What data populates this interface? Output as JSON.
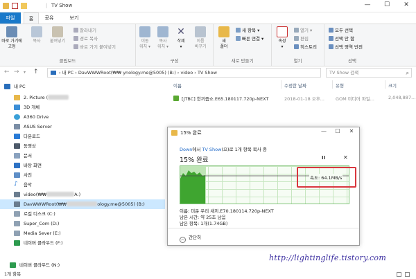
{
  "window": {
    "title": "TV Show",
    "separator": "|",
    "controls": {
      "minimize": "—",
      "maximize": "☐",
      "close": "✕"
    }
  },
  "ribbon_tabs": {
    "file": "파일",
    "home": "홈",
    "share": "공유",
    "view": "보기"
  },
  "ribbon": {
    "pin_quick": "바로 가기에\n고정",
    "copy": "복사",
    "paste": "붙여넣기",
    "cut": "잘라내기",
    "copy_path": "경로 복사",
    "paste_shortcut": "바로 가기 붙여넣기",
    "clipboard_group": "클립보드",
    "move_to": "이동\n위치 ▾",
    "copy_to": "복사\n위치 ▾",
    "delete": "삭제\n▾",
    "rename": "이름\n바꾸기",
    "organize_group": "구성",
    "new_folder": "새\n폴더",
    "new_item": "새 항목 ▾",
    "easy_access": "빠른 연결 ▾",
    "new_group": "새로 만들기",
    "properties": "속성\n▾",
    "open": "열기 ▾",
    "edit": "편집",
    "history": "히스토리",
    "open_group": "열기",
    "select_all": "모두 선택",
    "select_none": "선택 안 함",
    "invert_selection": "선택 영역 반전",
    "select_group": "선택"
  },
  "address": {
    "path": "› 내 PC › DavWWWRoot(₩₩          ynology.me@5005) (B:) › video › TV Show",
    "search_placeholder": "TV Show 검색"
  },
  "nav": {
    "items": [
      {
        "label": "내 PC"
      },
      {
        "label": "2. Picture ("
      },
      {
        "label": "3D 개체"
      },
      {
        "label": "A360 Drive"
      },
      {
        "label": "ASUS Server"
      },
      {
        "label": "다운로드"
      },
      {
        "label": "동영상"
      },
      {
        "label": "문서"
      },
      {
        "label": "바탕 화면"
      },
      {
        "label": "사진"
      },
      {
        "label": "음악"
      },
      {
        "label": "video(₩₩"
      },
      {
        "label": "DavWWWRoot(₩₩"
      },
      {
        "label": "로컬 디스크 (C:)"
      },
      {
        "label": "Super_Com (D:)"
      },
      {
        "label": "Media Sever (E:)"
      },
      {
        "label": "네이버 클라우드 (F:)"
      },
      {
        "label": "네이버 클라우드 (N:)"
      }
    ],
    "video_suffix": "A:)",
    "dav_suffix": "ology.me@5005) (B:)"
  },
  "file_list": {
    "columns": {
      "name": "이름",
      "date": "수정한 날짜",
      "type": "유형",
      "size": "크기"
    },
    "rows": [
      {
        "name": "[JTBC] 한끼줍쇼.E65.180117.720p-NEXT",
        "date": "2018-01-18 오후...",
        "type": "GOM 미디어 파일...",
        "size": "2,048,887..."
      }
    ]
  },
  "status": {
    "count": "1개 항목"
  },
  "dialog": {
    "title": "15% 완료",
    "desc_source": "Down",
    "desc_mid": "에서 ",
    "desc_dest": "TV Show",
    "desc_end": "(으)로 1개 항목 복사 중",
    "percent": "15% 완료",
    "pause": "II",
    "cancel": "✕",
    "speed": "속도: 64.1MB/s",
    "name_line": "이름: 미운 우리 새끼.E70.180114.720p-NEXT",
    "time_line": "남은 시간: 약 25초 남음",
    "items_line": "남은 항목: 1개(1.74GB)",
    "less_details": "간단히",
    "progress_fraction": 0.15
  },
  "watermark": "http://lightinglife.tistory.com"
}
